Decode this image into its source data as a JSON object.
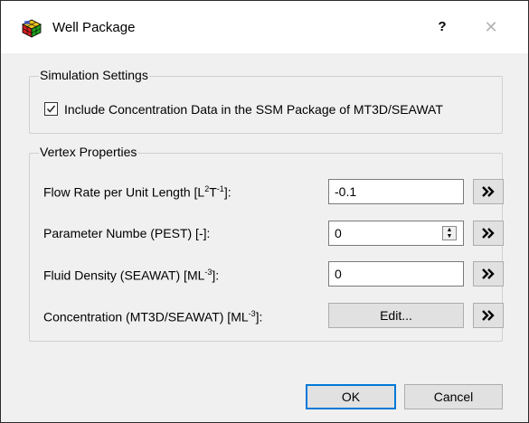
{
  "window": {
    "title": "Well Package",
    "help_label": "?",
    "close_label": "✕",
    "app_icon": "grid-cube-icon"
  },
  "simulation_settings": {
    "group_title": "Simulation Settings",
    "include_concentration": {
      "checked": true,
      "label": "Include Concentration Data in the SSM Package of MT3D/SEAWAT"
    }
  },
  "vertex_properties": {
    "group_title": "Vertex Properties",
    "rows": [
      {
        "label_pre": "Flow Rate per Unit Length [L",
        "sup1": "2",
        "label_mid": "T",
        "sup2": "-1",
        "label_post": "]:",
        "value": "-0.1"
      },
      {
        "label": "Parameter Numbe (PEST) [-]:",
        "value": "0"
      },
      {
        "label_pre": "Fluid Density (SEAWAT) [ML",
        "sup1": "-3",
        "label_post": "]:",
        "value": "0"
      },
      {
        "label_pre": "Concentration (MT3D/SEAWAT) [ML",
        "sup1": "-3",
        "label_post": "]:",
        "button": "Edit..."
      }
    ],
    "arrow_icon": "double-chevron-right-icon"
  },
  "footer": {
    "ok_label": "OK",
    "cancel_label": "Cancel"
  }
}
